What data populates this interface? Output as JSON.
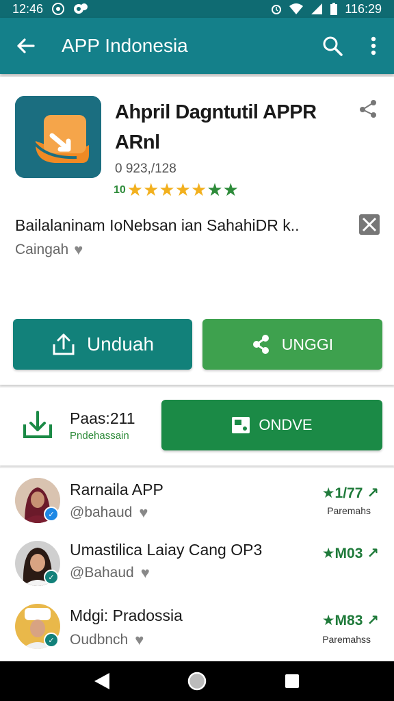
{
  "status_bar": {
    "time_left": "12:46",
    "time_right": "116:29"
  },
  "app_bar": {
    "title": "APP Indonesia",
    "icons": [
      "arrow-back-icon",
      "search-icon",
      "more-vert-icon"
    ]
  },
  "app": {
    "name_line1": "Ahpril Dagntutil APPR",
    "name_line2": "ARnl",
    "install_count": "0 923,/128",
    "rating_label": "10",
    "stars_gold": "★★★★★",
    "stars_green": "★★",
    "description": "Bailalaninam IoNebsan ian SahahiDR k..",
    "developer": "Caingah",
    "colors": {
      "icon_bg": "#1b6e80",
      "icon_accent": "#f08a24"
    }
  },
  "buttons": {
    "download_label": "Unduah",
    "share_label": "UNGGI"
  },
  "pages_section": {
    "title": "Paas:211",
    "subtitle": "Pndehassain",
    "online_button_label": "ONDVE"
  },
  "list_items": [
    {
      "title": "Rarnaila APP",
      "subtitle": "@bahaud",
      "rating": "★1/77",
      "caption": "Paremahs",
      "verified_color": "#1e88e5"
    },
    {
      "title": "Umastilica Laiay Cang OP3",
      "subtitle": "@Bahaud",
      "rating": "★M03",
      "caption": "",
      "verified_color": "#12817a"
    },
    {
      "title": "Mdgi: Pradossia",
      "subtitle": "Oudbnch",
      "rating": "★M83",
      "caption": "Paremahss",
      "verified_color": "#12817a"
    }
  ],
  "nav_bar": {
    "icons": [
      "back-triangle-icon",
      "home-circle-icon",
      "recents-square-icon"
    ]
  }
}
